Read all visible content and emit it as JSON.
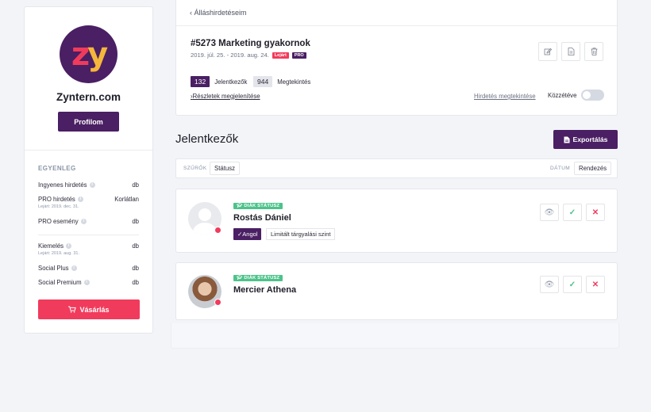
{
  "sidebar": {
    "logo_text_1": "z",
    "logo_text_2": "y",
    "company_name": "Zyntern.com",
    "profile_label": "Profilom",
    "balance_title": "EGYENLEG",
    "items": [
      {
        "label": "Ingyenes hirdetés",
        "value": "db",
        "sub": ""
      },
      {
        "label": "PRO hirdetés",
        "value": "Korlátlan",
        "sub": "Lejárt: 2019. dec. 31."
      },
      {
        "label": "PRO esemény",
        "value": "db",
        "sub": ""
      },
      {
        "label": "Kiemelés",
        "value": "db",
        "sub": "Lejárt: 2019. aug. 31."
      },
      {
        "label": "Social Plus",
        "value": "db",
        "sub": ""
      },
      {
        "label": "Social Premium",
        "value": "db",
        "sub": ""
      }
    ],
    "buy_label": "Vásárlás"
  },
  "job": {
    "back_label": "Álláshirdetéseim",
    "title": "#5273 Marketing gyakornok",
    "dates": "2019. júl. 25. - 2019. aug. 24.",
    "expired_badge": "Lejárt",
    "pro_badge": "PRO",
    "applicants_count": "132",
    "applicants_label": "Jelentkezők",
    "views_count": "944",
    "views_label": "Megtekintés",
    "details_label": "Részletek megjelenítése",
    "view_ad_label": "Hirdetés megtekintése",
    "publish_label": "Közzétéve",
    "published": false
  },
  "applicants_section": {
    "title": "Jelentkezők",
    "export_label": "Exportálás",
    "filters_label": "SZŰRŐK",
    "status_filter": "Státusz",
    "date_label": "DÁTUM",
    "sort_label": "Rendezés"
  },
  "applicants": [
    {
      "badge": "DIÁK STÁTUSZ",
      "name": "Rostás Dániel",
      "language": "Angol",
      "level": "Limitált tárgyalási szint"
    },
    {
      "badge": "DIÁK STÁTUSZ",
      "name": "Mercier Athena"
    }
  ],
  "colors": {
    "brand_purple": "#4a1f63",
    "accent_red": "#f13b5c",
    "success_green": "#4cc38a",
    "logo_yellow": "#f5b63c"
  }
}
